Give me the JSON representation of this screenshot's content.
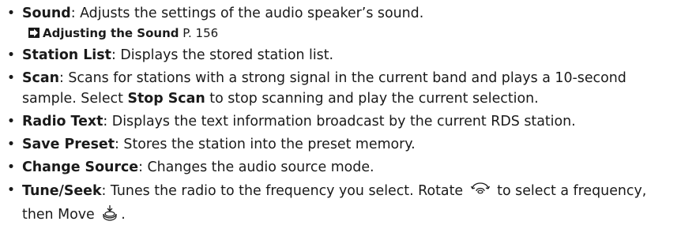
{
  "items": [
    {
      "term": "Sound",
      "text": ": Adjusts the settings of the audio speaker’s sound.",
      "ref": {
        "title": "Adjusting the Sound",
        "page": "P. 156"
      }
    },
    {
      "term": "Station List",
      "text": ": Displays the stored station list."
    },
    {
      "term": "Scan",
      "text_a": ": Scans for stations with a strong signal in the current band and plays a 10-second sample. Select ",
      "bold": "Stop Scan",
      "text_b": " to stop scanning and play the current selection."
    },
    {
      "term": "Radio Text",
      "text": ": Displays the text information broadcast by the current RDS station."
    },
    {
      "term": "Save Preset",
      "text": ": Stores the station into the preset memory."
    },
    {
      "term": "Change Source",
      "text": ": Changes the audio source mode."
    },
    {
      "term": "Tune/Seek",
      "text_a": ": Tunes the radio to the frequency you select. Rotate ",
      "icon_a": "rotate-knob-icon",
      "text_b": " to select a frequency, then Move ",
      "icon_b": "move-down-icon",
      "text_c": "."
    }
  ]
}
